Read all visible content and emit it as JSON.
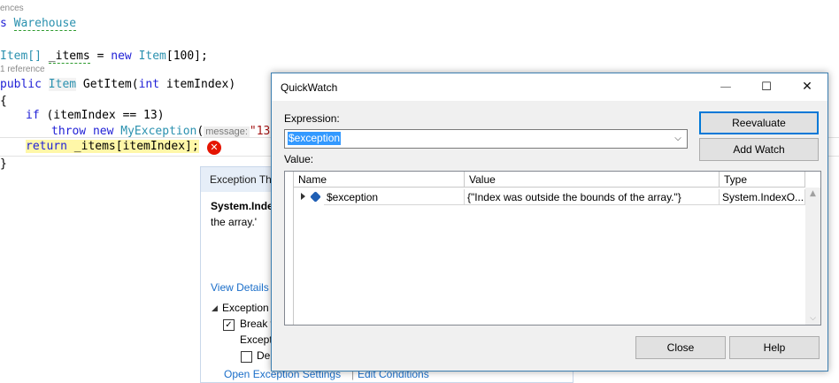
{
  "editor": {
    "lens_references": "ences",
    "class_kw": "s ",
    "class_name": "Warehouse",
    "items_decl": {
      "type": "Item[]",
      "var": "_items",
      "rest": " = ",
      "kw_new": "new",
      "rhs_type": "Item",
      "rhs_size": "[100];"
    },
    "lens_one_reference": "1 reference",
    "method_sig": {
      "kw_public": "public",
      "ret_type": "Item",
      "name": " GetItem(",
      "kw_int": "int",
      "param": " itemIndex)"
    },
    "brace_open": "{",
    "if_line": {
      "kw_if": "if",
      "cond": " (itemIndex == 13)"
    },
    "throw_line": {
      "kw_throw": "throw",
      "kw_new": "new",
      "type": "MyException",
      "paren": "(",
      "hint": "message:",
      "str": "\"13"
    },
    "return_line": {
      "kw_return": "return",
      "expr": " _items[itemIndex];"
    },
    "brace_close": "}",
    "error_glyph": "✕"
  },
  "exception_helper": {
    "title": "Exception Th",
    "type_text": "System.Inde",
    "message_text": "the array.'",
    "view_details": "View Details",
    "settings_header": "Exception",
    "break_when": "Break w",
    "except_text": "Except",
    "deb_text": "Deb",
    "open_settings": "Open Exception Settings",
    "separator": "|",
    "edit_conditions": "Edit Conditions"
  },
  "quickwatch": {
    "title": "QuickWatch",
    "minimize_glyph": "—",
    "maximize_glyph": "☐",
    "close_glyph": "✕",
    "expression_label": "Expression:",
    "expression_value": "$exception",
    "value_label": "Value:",
    "reevaluate": "Reevaluate",
    "add_watch": "Add Watch",
    "columns": {
      "name": "Name",
      "value": "Value",
      "type": "Type"
    },
    "rows": [
      {
        "name": "$exception",
        "value": "{\"Index was outside the bounds of the array.\"}",
        "type": "System.IndexO..."
      }
    ],
    "close": "Close",
    "help": "Help"
  }
}
